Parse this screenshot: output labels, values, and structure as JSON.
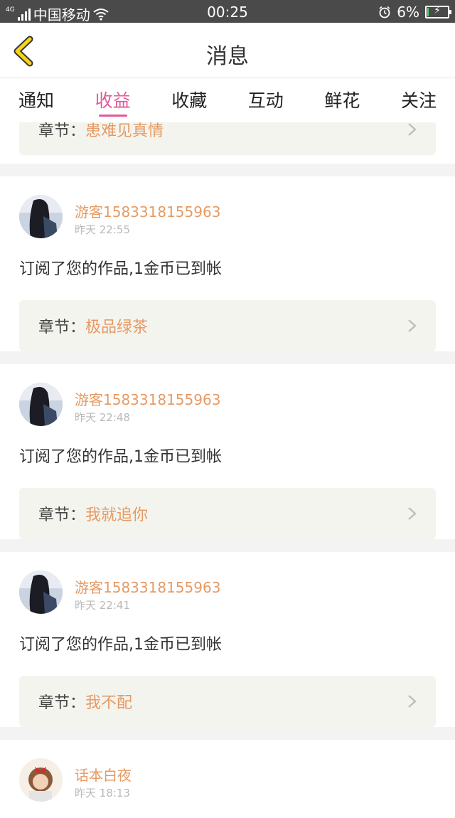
{
  "status_bar": {
    "network": "4G",
    "carrier": "中国移动",
    "time": "00:25",
    "battery_percent": "6%",
    "battery_level": 0.06
  },
  "header": {
    "title": "消息",
    "back_icon": "chevron-left-icon"
  },
  "tabs": [
    {
      "label": "通知",
      "active": false
    },
    {
      "label": "收益",
      "active": true
    },
    {
      "label": "收藏",
      "active": false
    },
    {
      "label": "互动",
      "active": false
    },
    {
      "label": "鲜花",
      "active": false
    },
    {
      "label": "关注",
      "active": false
    }
  ],
  "colors": {
    "accent": "#e2599a",
    "name_orange": "#e59a64",
    "chapter_bg": "#f4f4ee"
  },
  "partial_top": {
    "chapter_label": "章节：",
    "chapter_name": "患难见真情"
  },
  "messages": [
    {
      "user": "游客1583318155963",
      "time": "昨天 22:55",
      "text": "订阅了您的作品,1金币已到帐",
      "chapter_label": "章节：",
      "chapter_name": "极品绿茶"
    },
    {
      "user": "游客1583318155963",
      "time": "昨天 22:48",
      "text": "订阅了您的作品,1金币已到帐",
      "chapter_label": "章节：",
      "chapter_name": "我就追你"
    },
    {
      "user": "游客1583318155963",
      "time": "昨天 22:41",
      "text": "订阅了您的作品,1金币已到帐",
      "chapter_label": "章节：",
      "chapter_name": "我不配"
    },
    {
      "user": "话本白夜",
      "time": "昨天 18:13"
    }
  ]
}
